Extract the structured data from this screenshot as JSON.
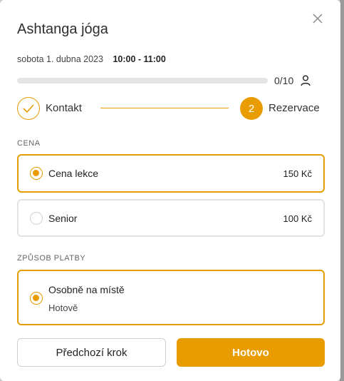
{
  "modal": {
    "title": "Ashtanga jóga",
    "date": "sobota 1. dubna 2023",
    "time": "10:00 - 11:00",
    "close_icon": "close-icon"
  },
  "capacity": {
    "count_label": "0/10",
    "filled": 0,
    "total": 10,
    "icon": "person-icon"
  },
  "steps": [
    {
      "label": "Kontakt",
      "state": "done",
      "icon": "check-icon"
    },
    {
      "label": "Rezervace",
      "number": "2",
      "state": "active"
    }
  ],
  "price_section": {
    "label": "CENA",
    "options": [
      {
        "name": "Cena lekce",
        "price": "150 Kč",
        "selected": true
      },
      {
        "name": "Senior",
        "price": "100 Kč",
        "selected": false
      }
    ]
  },
  "payment_section": {
    "label": "ZPŮSOB PLATBY",
    "options": [
      {
        "name": "Osobně na místě",
        "detail": "Hotově",
        "selected": true
      }
    ]
  },
  "buttons": {
    "prev": "Předchozí krok",
    "done": "Hotovo"
  },
  "colors": {
    "accent": "#e89c00",
    "border": "#e2e2e2"
  }
}
